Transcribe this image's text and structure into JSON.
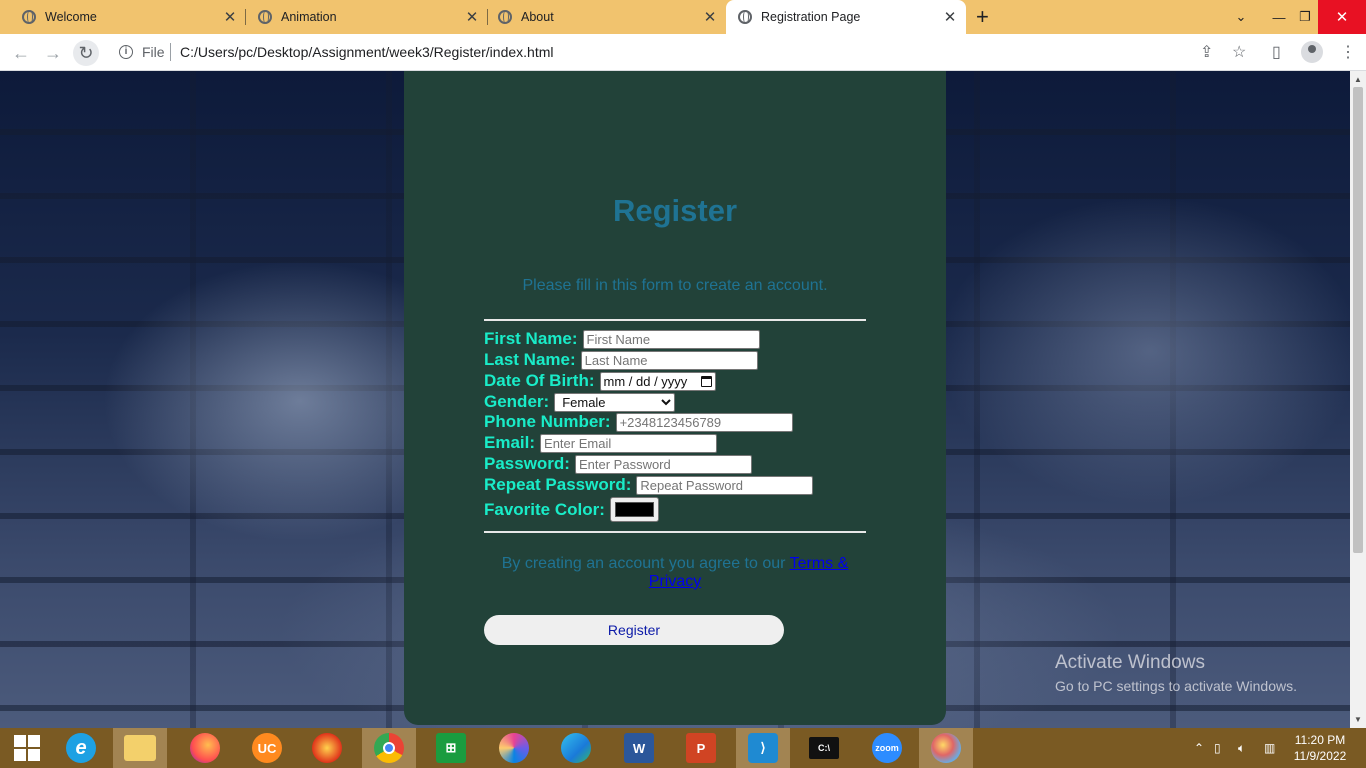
{
  "browser": {
    "tabs": [
      {
        "title": "Welcome"
      },
      {
        "title": "Animation"
      },
      {
        "title": "About"
      },
      {
        "title": "Registration Page"
      }
    ],
    "close_glyph": "✕",
    "new_tab_glyph": "+",
    "file_label": "File",
    "url": "C:/Users/pc/Desktop/Assignment/week3/Register/index.html"
  },
  "form": {
    "title": "Register",
    "subtitle": "Please fill in this form to create an account.",
    "first_name_label": "First Name:",
    "first_name_placeholder": "First Name",
    "last_name_label": "Last Name:",
    "last_name_placeholder": "Last Name",
    "dob_label": "Date Of Birth:",
    "dob_value": "mm / dd / yyyy",
    "gender_label": "Gender:",
    "gender_value": "Female",
    "phone_label": "Phone Number:",
    "phone_placeholder": "+2348123456789",
    "email_label": "Email:",
    "email_placeholder": "Enter Email",
    "password_label": "Password:",
    "password_placeholder": "Enter Password",
    "repeat_label": "Repeat Password:",
    "repeat_placeholder": "Repeat Password",
    "color_label": "Favorite Color:",
    "color_value": "#000000",
    "terms_prefix": "By creating an account you agree to our",
    "terms_link": "Terms & Privacy",
    "submit_label": "Register"
  },
  "watermark": {
    "line1": "Activate Windows",
    "line2": "Go to PC settings to activate Windows."
  },
  "clock": {
    "time": "11:20 PM",
    "date": "11/9/2022"
  },
  "colors": {
    "tab_strip": "#f1c36e",
    "card": "#224239",
    "label": "#19ecc8",
    "heading": "#1f7393",
    "taskbar": "#7a5a23"
  }
}
